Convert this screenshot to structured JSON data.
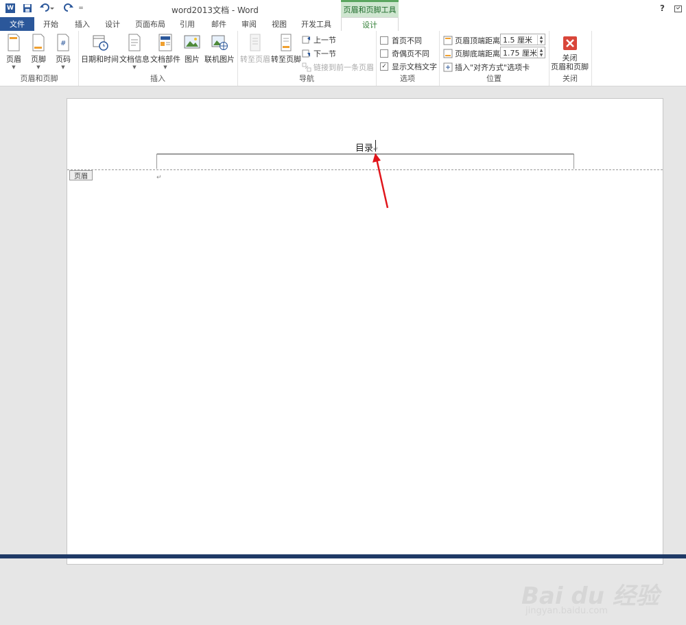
{
  "window": {
    "title": "word2013文档 - Word",
    "help": "?",
    "logo_letter": "W",
    "context_group": "页眉和页脚工具",
    "qat_more": "="
  },
  "tabs": [
    "开始",
    "插入",
    "设计",
    "页面布局",
    "引用",
    "邮件",
    "审阅",
    "视图",
    "开发工具"
  ],
  "file_tab": "文件",
  "active_tab": "设计",
  "ribbon": {
    "groups": {
      "header_footer": "页眉和页脚",
      "insert": "插入",
      "navigation": "导航",
      "options": "选项",
      "position": "位置",
      "close": "关闭"
    },
    "header_btn": "页眉",
    "footer_btn": "页脚",
    "page_number_btn": "页码",
    "datetime_btn": "日期和时间",
    "docinfo_btn": "文档信息",
    "docparts_btn": "文档部件",
    "picture_btn": "图片",
    "online_picture_btn": "联机图片",
    "goto_header_btn": "转至页眉",
    "goto_footer_btn": "转至页脚",
    "prev_section": "上一节",
    "next_section": "下一节",
    "link_previous": "链接到前一条页眉",
    "opt_first_page": "首页不同",
    "opt_odd_even": "奇偶页不同",
    "opt_show_text": "显示文档文字",
    "opt_show_text_checked": "✓",
    "header_top_label": "页眉顶端距离:",
    "header_top_value": "1.5 厘米",
    "footer_bottom_label": "页脚底端距离:",
    "footer_bottom_value": "1.75 厘米",
    "insert_align_tab": "插入\"对齐方式\"选项卡",
    "close_btn_line1": "关闭",
    "close_btn_line2": "页眉和页脚"
  },
  "document": {
    "header_text": "目录",
    "para_mark": "↵",
    "header_badge": "页眉"
  },
  "watermark": {
    "brand": "Bai du 经验",
    "url": "jingyan.baidu.com"
  },
  "colors": {
    "word_blue": "#2b579a",
    "context_green": "#5aa55f",
    "arrow_red": "#e0151b",
    "close_red": "#d9463a"
  }
}
